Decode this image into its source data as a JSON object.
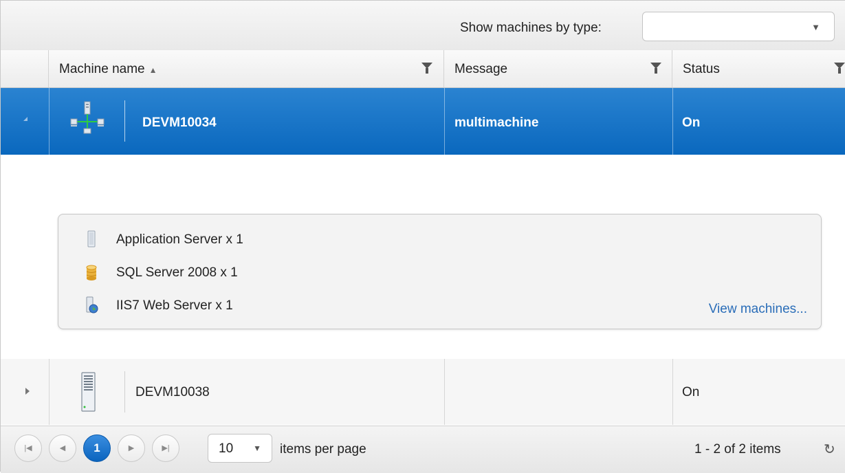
{
  "toolbar": {
    "filter_label": "Show machines by type:",
    "type_select_value": ""
  },
  "columns": {
    "machine_name": "Machine name",
    "machine_sort_indicator": "▲",
    "message": "Message",
    "status": "Status"
  },
  "rows": [
    {
      "name": "DEVM10034",
      "message": "multimachine",
      "status": "On",
      "icon": "multi-machine-network-icon",
      "expanded": true,
      "selected": true
    },
    {
      "name": "DEVM10038",
      "message": "",
      "status": "On",
      "icon": "server-tower-icon",
      "expanded": false,
      "selected": false
    }
  ],
  "detail": {
    "items": [
      {
        "label": "Application Server x 1",
        "icon": "application-server-icon"
      },
      {
        "label": "SQL Server 2008 x 1",
        "icon": "database-icon"
      },
      {
        "label": "IIS7 Web Server x 1",
        "icon": "web-server-icon"
      }
    ],
    "view_link": "View machines..."
  },
  "pager": {
    "current_page": "1",
    "page_size": "10",
    "items_per_page_label": "items per page",
    "info": "1 - 2 of 2 items"
  },
  "colors": {
    "selected_row": "#1a73c8",
    "link": "#2a6db8",
    "active_page": "#1f7ad4"
  }
}
